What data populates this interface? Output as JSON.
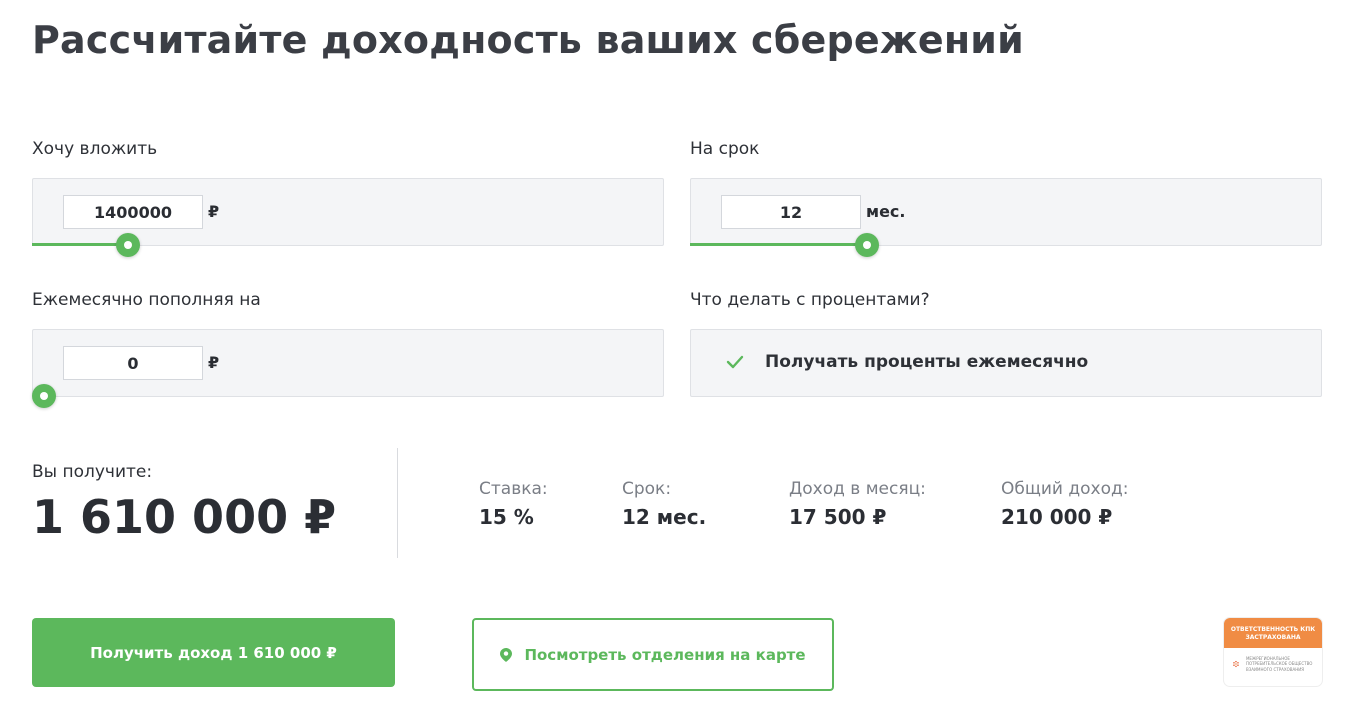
{
  "title": "Рассчитайте доходность ваших сбережений",
  "invest": {
    "label": "Хочу вложить",
    "value": "1400000",
    "unit": "₽",
    "slider_level": 0.15
  },
  "term": {
    "label": "На срок",
    "value": "12",
    "unit": "мес.",
    "slider_level": 0.28
  },
  "topup": {
    "label": "Ежемесячно пополняя на",
    "value": "0",
    "unit": "₽",
    "slider_level": 0
  },
  "interest": {
    "label": "Что делать с процентами?",
    "option": "Получать проценты ежемесячно"
  },
  "result": {
    "label": "Вы получите:",
    "value": "1 610 000 ₽"
  },
  "stats": {
    "rate_label": "Ставка:",
    "rate_value": "15 %",
    "term_label": "Срок:",
    "term_value": "12 мес.",
    "monthly_label": "Доход в месяц:",
    "monthly_value": "17 500 ₽",
    "total_label": "Общий доход:",
    "total_value": "210 000 ₽"
  },
  "buttons": {
    "get_income": "Получить доход 1 610 000 ₽",
    "map": "Посмотреть отделения на карте"
  },
  "badge": {
    "title": "ОТВЕТСТВЕННОСТЬ КПК ЗАСТРАХОВАНА",
    "text": "МЕЖРЕГИОНАЛЬНОЕ ПОТРЕБИТЕЛЬСКОЕ ОБЩЕСТВО ВЗАИМНОГО СТРАХОВАНИЯ"
  },
  "colors": {
    "accent": "#5cb85c",
    "badge": "#f08c44"
  }
}
